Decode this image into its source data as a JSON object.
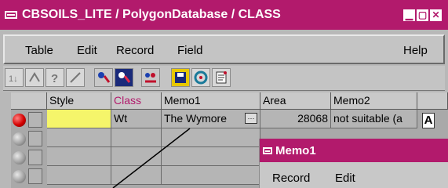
{
  "window": {
    "title": "CBSOILS_LITE / PolygonDatabase / CLASS",
    "controls": {
      "minimize": "▁",
      "restore": "▢",
      "close": "✕"
    },
    "accent_color": "#b21a6c"
  },
  "menubar": {
    "table": "Table",
    "edit": "Edit",
    "record": "Record",
    "field": "Field",
    "help": "Help"
  },
  "toolbar": {
    "buttons": [
      "sort-ascending-icon",
      "sort-descending-icon",
      "query-icon",
      "filter-icon",
      "select-icon",
      "select-all-icon",
      "tag-icon",
      "save-icon",
      "refresh-icon",
      "report-icon"
    ]
  },
  "table": {
    "columns": [
      "Style",
      "Class",
      "Memo1",
      "Area",
      "Memo2"
    ],
    "class_header_color": "#b21a6c",
    "row1": {
      "class": "Wt",
      "memo1": "The Wymore",
      "memo1_btn": "···",
      "area": "28068",
      "memo2": "not suitable  (a"
    },
    "scroll_marker": "A"
  },
  "memo_window": {
    "title": "Memo1",
    "menu": {
      "record": "Record",
      "edit": "Edit"
    }
  }
}
